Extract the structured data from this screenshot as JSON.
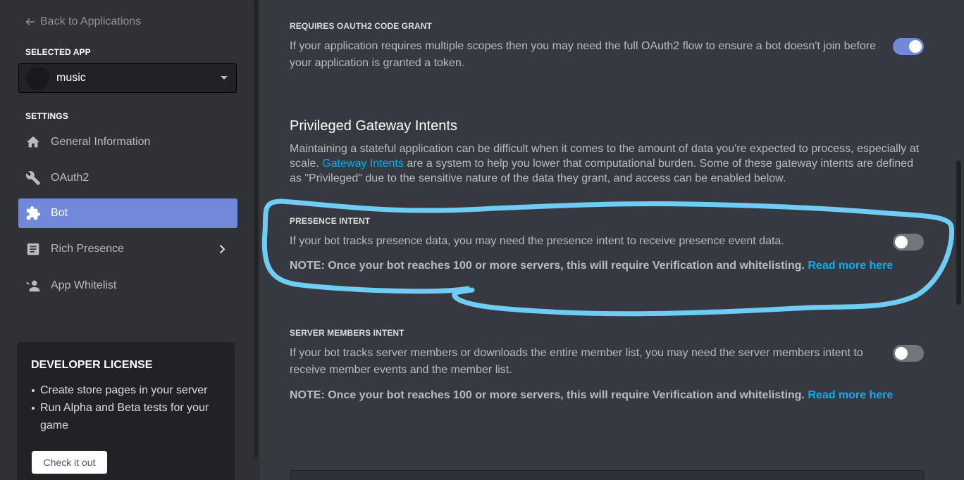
{
  "sidebar": {
    "back_label": "Back to Applications",
    "selected_app_label": "SELECTED APP",
    "selected_app_name": "music",
    "settings_label": "SETTINGS",
    "items": [
      {
        "label": "General Information",
        "icon": "home-icon"
      },
      {
        "label": "OAuth2",
        "icon": "wrench-icon"
      },
      {
        "label": "Bot",
        "icon": "puzzle-icon",
        "active": true
      },
      {
        "label": "Rich Presence",
        "icon": "document-icon",
        "has_submenu": true
      },
      {
        "label": "App Whitelist",
        "icon": "user-icon"
      }
    ],
    "license": {
      "title": "DEVELOPER LICENSE",
      "bullets": [
        "Create store pages in your server",
        "Run Alpha and Beta tests for your game"
      ],
      "button": "Check it out"
    }
  },
  "main": {
    "oauth_grant": {
      "title": "REQUIRES OAUTH2 CODE GRANT",
      "description": "If your application requires multiple scopes then you may need the full OAuth2 flow to ensure a bot doesn't join before your application is granted a token.",
      "enabled": true
    },
    "intents_heading": "Privileged Gateway Intents",
    "intents_intro_before": "Maintaining a stateful application can be difficult when it comes to the amount of data you're expected to process, especially at scale. ",
    "intents_intro_link": "Gateway Intents",
    "intents_intro_after": " are a system to help you lower that computational burden. Some of these gateway intents are defined as \"Privileged\" due to the sensitive nature of the data they grant, and access can be enabled below.",
    "presence": {
      "title": "PRESENCE INTENT",
      "description": "If your bot tracks presence data, you may need the presence intent to receive presence event data.",
      "note": "NOTE: Once your bot reaches 100 or more servers, this will require Verification and whitelisting.",
      "link": "Read more here",
      "enabled": false
    },
    "members": {
      "title": "SERVER MEMBERS INTENT",
      "description": "If your bot tracks server members or downloads the entire member list, you may need the server members intent to receive member events and the member list.",
      "note": "NOTE: Once your bot reaches 100 or more servers, this will require Verification and whitelisting.",
      "link": "Read more here",
      "enabled": false
    }
  },
  "colors": {
    "accent": "#7289da",
    "link": "#00b0f4",
    "annotation": "#6fcdf5"
  }
}
